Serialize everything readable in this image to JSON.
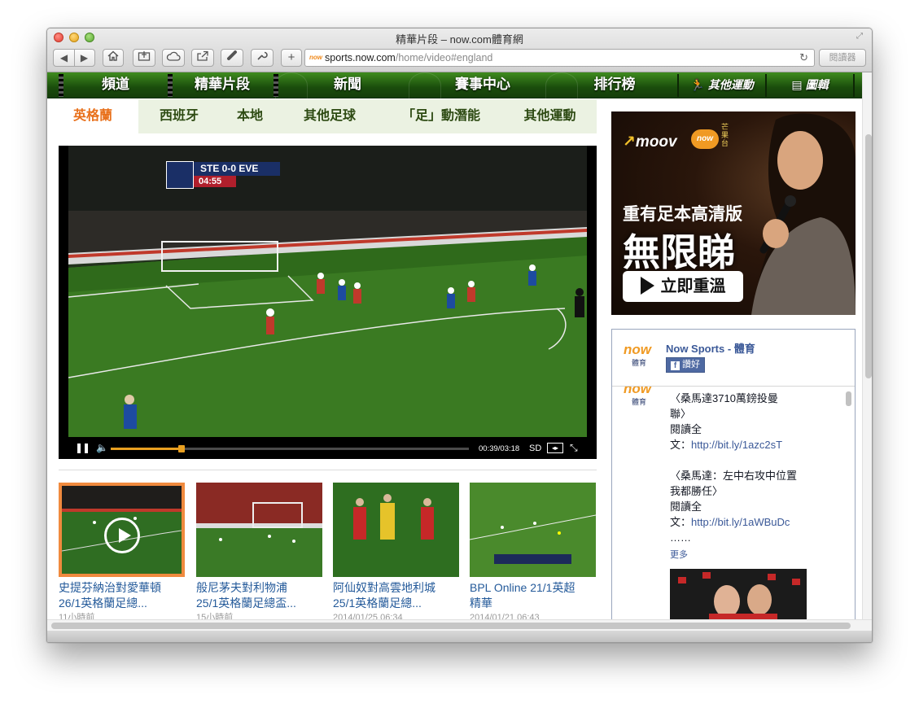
{
  "window": {
    "title": "精華片段 – now.com體育網"
  },
  "toolbar": {
    "back_icon": "◀",
    "forward_icon": "▶",
    "url_favicon": "now",
    "url_domain": "sports.now.com",
    "url_path": "/home/video#england",
    "reader_label": "閱讀器"
  },
  "site_nav": {
    "items": [
      "頻道",
      "精華片段",
      "新聞",
      "賽事中心",
      "排行榜"
    ],
    "other_sports": "其他運動",
    "gallery": "圖輯"
  },
  "sub_tabs": [
    "英格蘭",
    "西班牙",
    "本地",
    "其他足球",
    "「足」動潛能",
    "其他運動"
  ],
  "active_sub_tab": "英格蘭",
  "player": {
    "scoreboard": "STE 0-0 EVE",
    "match_clock": "04:55",
    "time_display": "00:39/03:18",
    "quality": "SD",
    "progress": 0.197
  },
  "thumbnails": [
    {
      "title_line1": "史提芬納治對愛華頓",
      "title_line2": "26/1英格蘭足總...",
      "date": "11小時前"
    },
    {
      "title_line1": "般尼茅夫對利物浦",
      "title_line2": "25/1英格蘭足總盃...",
      "date": "15小時前"
    },
    {
      "title_line1": "阿仙奴對高雲地利城",
      "title_line2": "25/1英格蘭足總...",
      "date": "2014/01/25 06:34"
    },
    {
      "title_line1": "BPL Online 21/1英超",
      "title_line2": "精華",
      "date": "2014/01/21 06:43"
    }
  ],
  "ad": {
    "brand": "moov",
    "now_logo": "now",
    "now_tag": "芒果台",
    "line1": "重有足本高清版",
    "line2": "無限睇",
    "cta": "立即重溫"
  },
  "facebook": {
    "logo_text": "now",
    "logo_tag": "體育",
    "page_name": "Now Sports - 體育",
    "like_label": "讚好",
    "post_lines": [
      "〈桑馬達3710萬鎊投曼",
      "聯〉",
      "閱讀全",
      "文："
    ],
    "post_link1": "http://bit.ly/1azc2sT",
    "post2_lines": [
      "〈桑馬達：左中右攻中位置",
      "我都勝任〉",
      "閱讀全",
      "文："
    ],
    "post_link2": "http://bit.ly/1aWBuDc",
    "ellipsis": "……",
    "more_label": "更多"
  },
  "colors": {
    "nav_green": "#1a4c0c",
    "subtab_bg": "#ebf2e2",
    "active_orange": "#e8701b",
    "link_blue": "#245a9a",
    "fb_blue": "#3b5998",
    "progress": "#e9a021"
  }
}
